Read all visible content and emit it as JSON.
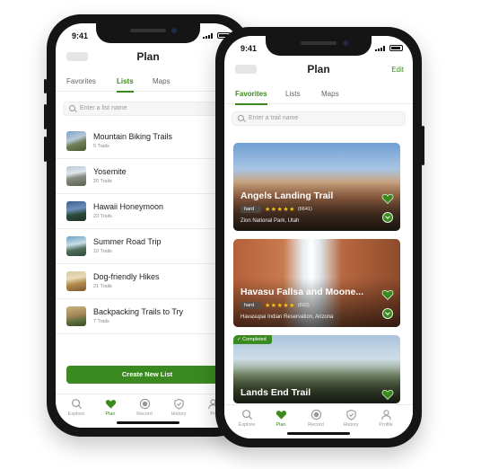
{
  "status": {
    "time": "9:41"
  },
  "back_screen": {
    "title": "Plan",
    "tabs": [
      {
        "label": "Favorites",
        "active": false
      },
      {
        "label": "Lists",
        "active": true
      },
      {
        "label": "Maps",
        "active": false
      }
    ],
    "search_placeholder": "Enter a list name",
    "lists": [
      {
        "name": "Mountain Biking Trails",
        "count": "5 Trails"
      },
      {
        "name": "Yosemite",
        "count": "20 Trails"
      },
      {
        "name": "Hawaii Honeymoon",
        "count": "23 Trails"
      },
      {
        "name": "Summer Road Trip",
        "count": "10 Trails"
      },
      {
        "name": "Dog-friendly Hikes",
        "count": "21 Trails"
      },
      {
        "name": "Backpacking Trails to Try",
        "count": "7 Trails"
      }
    ],
    "create_button": "Create New List",
    "nav": [
      {
        "label": "Explore",
        "icon": "search-icon"
      },
      {
        "label": "Plan",
        "icon": "heart-icon"
      },
      {
        "label": "Record",
        "icon": "record-icon"
      },
      {
        "label": "History",
        "icon": "shield-check-icon"
      },
      {
        "label": "Pr",
        "icon": "profile-icon"
      }
    ]
  },
  "front_screen": {
    "title": "Plan",
    "edit_label": "Edit",
    "tabs": [
      {
        "label": "Favorites",
        "active": true
      },
      {
        "label": "Lists",
        "active": false
      },
      {
        "label": "Maps",
        "active": false
      }
    ],
    "search_placeholder": "Enter a trail name",
    "trails": [
      {
        "name": "Angels Landing Trail",
        "difficulty": "hard",
        "stars": "★★★★★",
        "rating": 5,
        "reviews": "(6641)",
        "location": "Zion National Park, Utah",
        "completed": false
      },
      {
        "name": "Havasu Fallsa and Moone...",
        "difficulty": "hard",
        "stars": "★★★★★",
        "rating": 5,
        "reviews": "(692)",
        "location": "Havasupai Indian Reservation, Arizona",
        "completed": false
      },
      {
        "name": "Lands End Trail",
        "difficulty": "",
        "stars": "",
        "rating": null,
        "reviews": "",
        "location": "",
        "completed": true,
        "completed_label": "Completed"
      }
    ],
    "nav": [
      {
        "label": "Explore",
        "icon": "search-icon"
      },
      {
        "label": "Plan",
        "icon": "heart-icon"
      },
      {
        "label": "Record",
        "icon": "record-icon"
      },
      {
        "label": "History",
        "icon": "shield-check-icon"
      },
      {
        "label": "Profile",
        "icon": "profile-icon"
      }
    ]
  },
  "colors": {
    "accent": "#3a8a1f",
    "star": "#f5c518",
    "frame": "#151515"
  }
}
